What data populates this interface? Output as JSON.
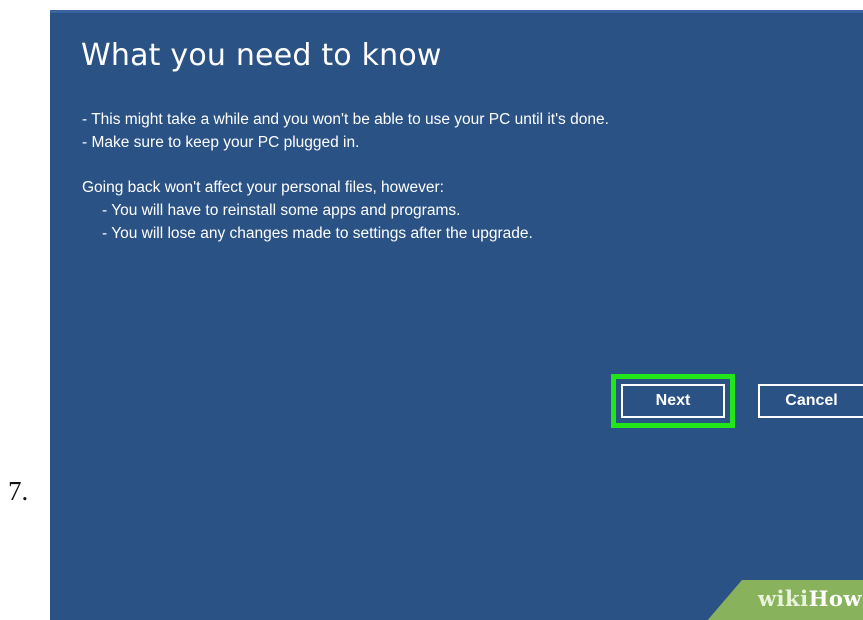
{
  "step": {
    "number": "7."
  },
  "dialog": {
    "title": "What you need to know",
    "intro_lines": [
      "- This might take a while and you won't be able to use your PC until it's done.",
      "- Make sure to keep your PC plugged in."
    ],
    "note": "Going back won't affect your personal files, however:",
    "note_items": [
      "- You will have to reinstall some apps and programs.",
      "- You will lose any changes made to settings after the upgrade."
    ],
    "buttons": {
      "next": "Next",
      "cancel": "Cancel"
    }
  },
  "watermark": {
    "part1": "wiki",
    "part2": "How"
  },
  "colors": {
    "dialog_background": "#2a5285",
    "highlight": "#22e51a",
    "watermark_background": "#88b35c"
  }
}
